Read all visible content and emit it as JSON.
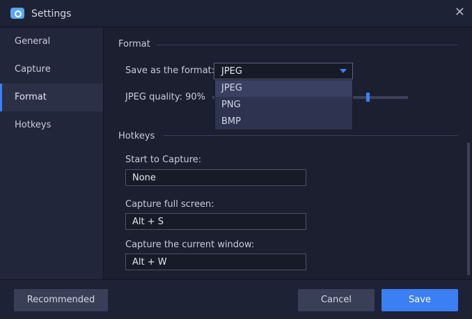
{
  "window": {
    "title": "Settings"
  },
  "sidebar": {
    "items": [
      {
        "label": "General"
      },
      {
        "label": "Capture"
      },
      {
        "label": "Format"
      },
      {
        "label": "Hotkeys"
      }
    ],
    "active": "Format"
  },
  "format": {
    "section_title": "Format",
    "save_label": "Save as the format:",
    "selected": "JPEG",
    "options": [
      "JPEG",
      "PNG",
      "BMP"
    ],
    "quality_label": "JPEG quality: 90%",
    "quality_value": 90
  },
  "hotkeys": {
    "section_title": "Hotkeys",
    "items": [
      {
        "label": "Start to Capture:",
        "value": "None"
      },
      {
        "label": "Capture full screen:",
        "value": "Alt + S"
      },
      {
        "label": "Capture the current window:",
        "value": "Alt + W"
      }
    ]
  },
  "footer": {
    "recommended": "Recommended",
    "cancel": "Cancel",
    "save": "Save"
  },
  "colors": {
    "accent": "#3b82f6"
  }
}
